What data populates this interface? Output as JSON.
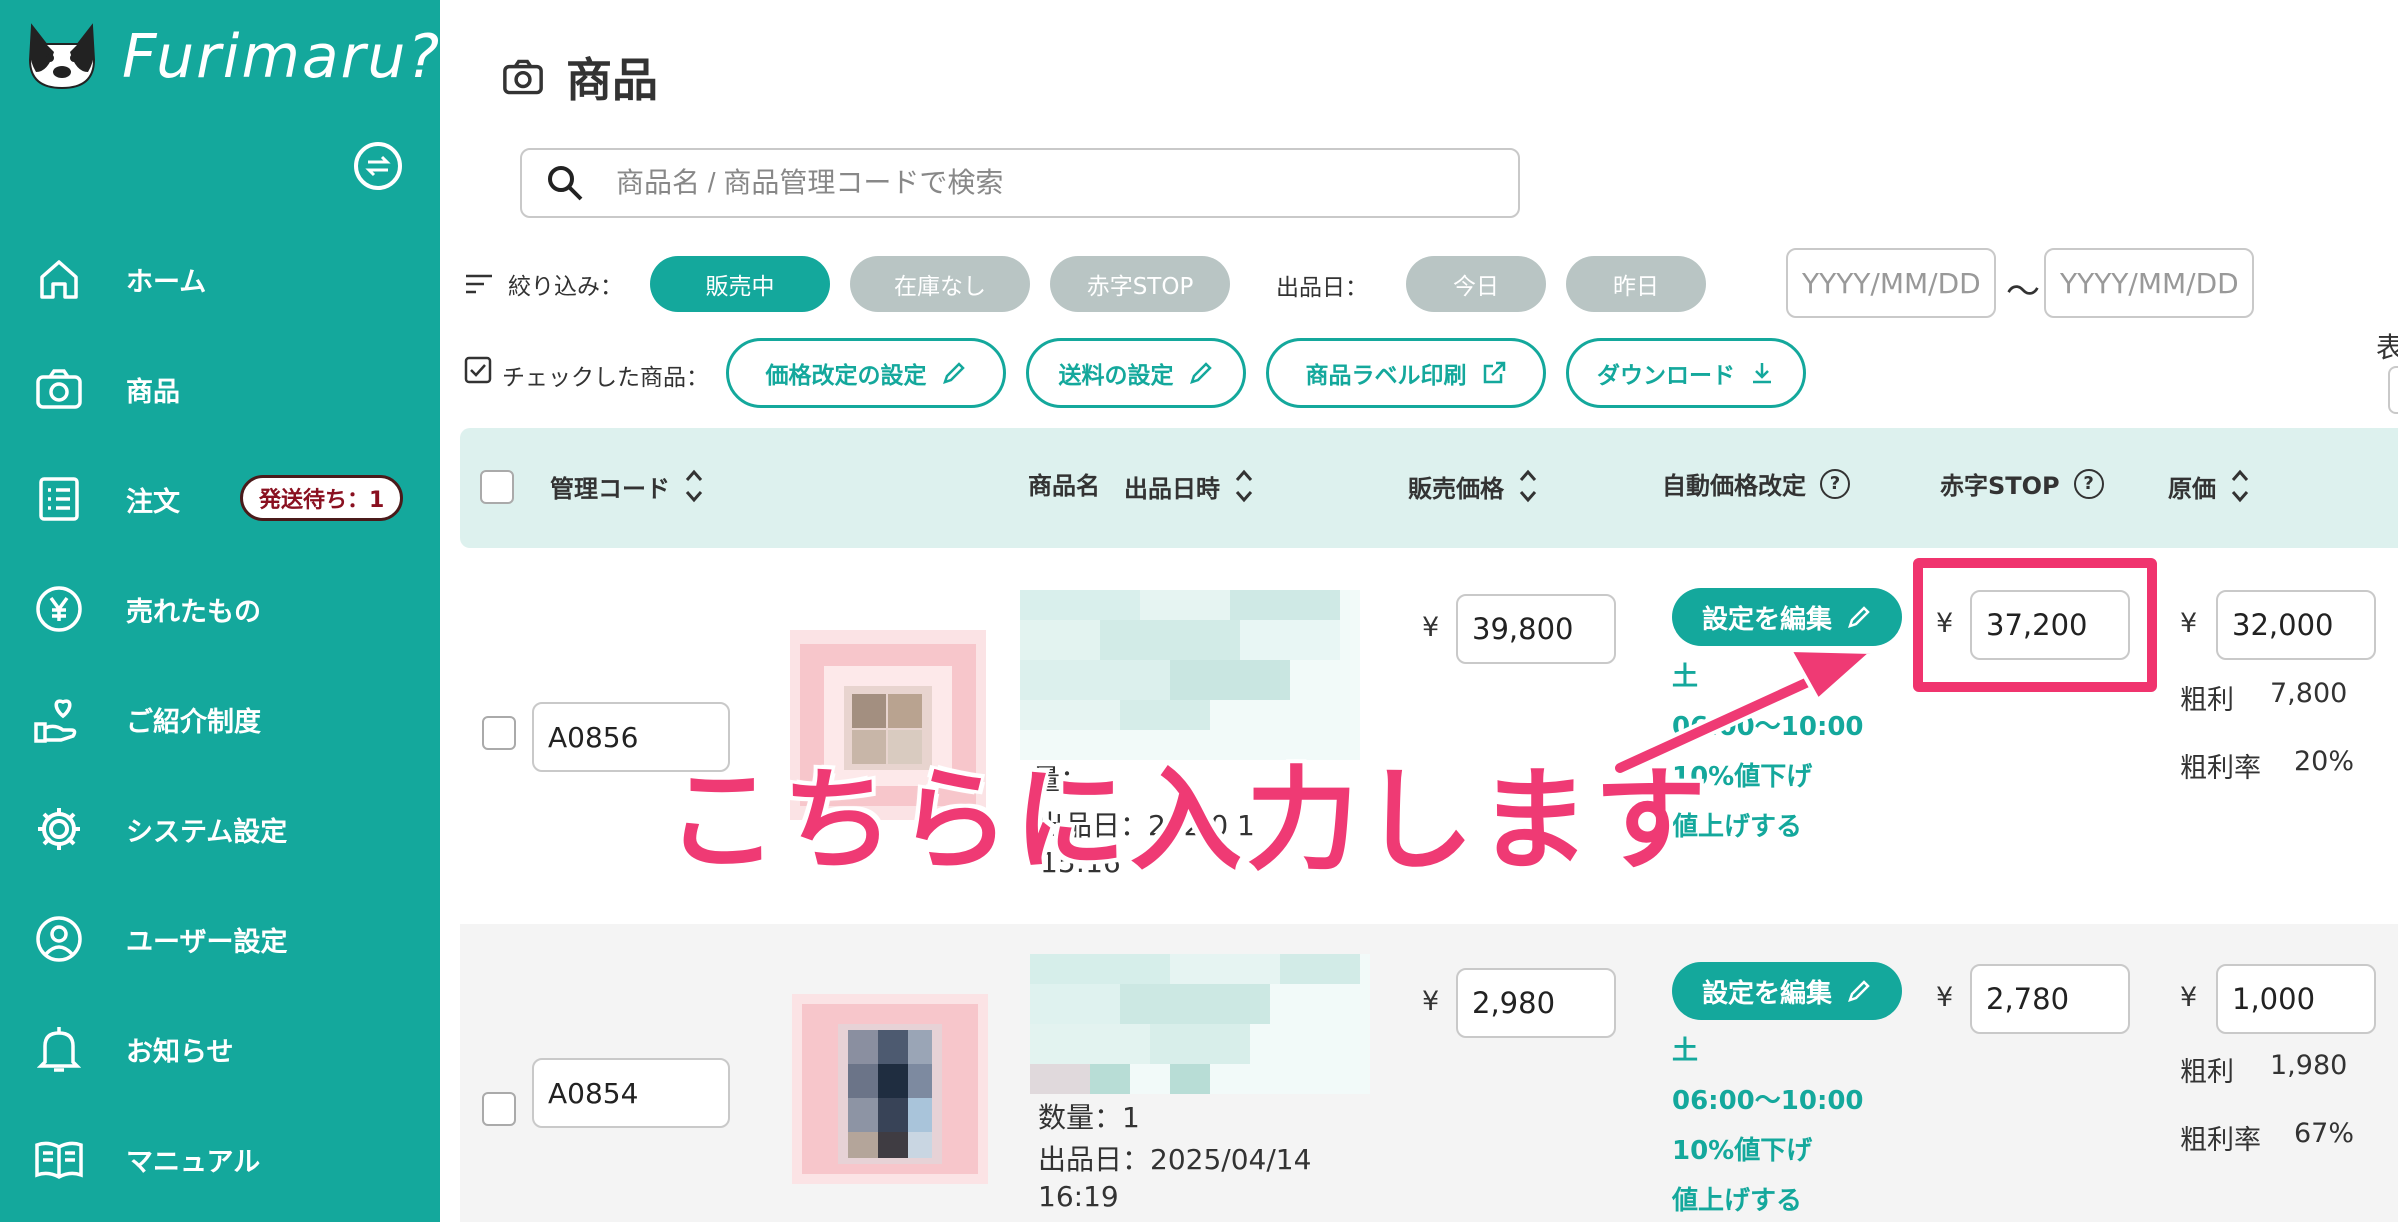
{
  "app": {
    "name": "Furimaru?"
  },
  "sidebar": {
    "items": [
      {
        "label": "ホーム",
        "icon": "home-icon"
      },
      {
        "label": "商品",
        "icon": "camera-icon"
      },
      {
        "label": "注文",
        "icon": "list-icon",
        "badge": "発送待ち：1"
      },
      {
        "label": "売れたもの",
        "icon": "yen-icon"
      },
      {
        "label": "ご紹介制度",
        "icon": "heart-hand-icon"
      },
      {
        "label": "システム設定",
        "icon": "gear-icon"
      },
      {
        "label": "ユーザー設定",
        "icon": "user-icon"
      },
      {
        "label": "お知らせ",
        "icon": "bell-icon"
      },
      {
        "label": "マニュアル",
        "icon": "book-icon"
      }
    ]
  },
  "page": {
    "title": "商品"
  },
  "search": {
    "placeholder": "商品名 / 商品管理コードで検索"
  },
  "filters": {
    "label": "絞り込み：",
    "status": [
      "販売中",
      "在庫なし",
      "赤字STOP"
    ],
    "date_label": "出品日：",
    "date_pills": [
      "今日",
      "昨日"
    ],
    "date_from_placeholder": "YYYY/MM/DD",
    "date_to_placeholder": "YYYY/MM/DD",
    "range_sep": "〜"
  },
  "actions": {
    "label": "チェックした商品：",
    "buttons": [
      "価格改定の設定",
      "送料の設定",
      "商品ラベル印刷",
      "ダウンロード"
    ],
    "cut_label": "表"
  },
  "table": {
    "headers": {
      "code": "管理コード",
      "name": "商品名",
      "listed": "出品日時",
      "price": "販売価格",
      "auto": "自動価格改定",
      "stop": "赤字STOP",
      "cost": "原価"
    },
    "rows": [
      {
        "code": "A0856",
        "qty": "量：",
        "listed_line": "出品日：202 0 1",
        "time": "15:16",
        "currency": "¥",
        "price": "39,800",
        "edit_label": "設定を編集",
        "rule_day": "土",
        "rule_time": "06:00〜10:00",
        "rule_change": "10%値下げ",
        "rule_up": "値上げする",
        "stop_price": "37,200",
        "cost": "32,000",
        "profit_label": "粗利",
        "profit": "7,800",
        "rate_label": "粗利率",
        "rate": "20%"
      },
      {
        "code": "A0854",
        "qty": "数量：1",
        "listed_line": "出品日：2025/04/14",
        "time": "16:19",
        "currency": "¥",
        "price": "2,980",
        "edit_label": "設定を編集",
        "rule_day": "土",
        "rule_time": "06:00〜10:00",
        "rule_change": "10%値下げ",
        "rule_up": "値上げする",
        "stop_price": "2,780",
        "cost": "1,000",
        "profit_label": "粗利",
        "profit": "1,980",
        "rate_label": "粗利率",
        "rate": "67%"
      }
    ]
  },
  "annotation": {
    "text": "こちらに入力します",
    "color": "#ef3a74"
  },
  "colors": {
    "brand": "#14a89c",
    "header_bg": "#ddf1ee",
    "inactive_pill": "#b9c5c4"
  }
}
